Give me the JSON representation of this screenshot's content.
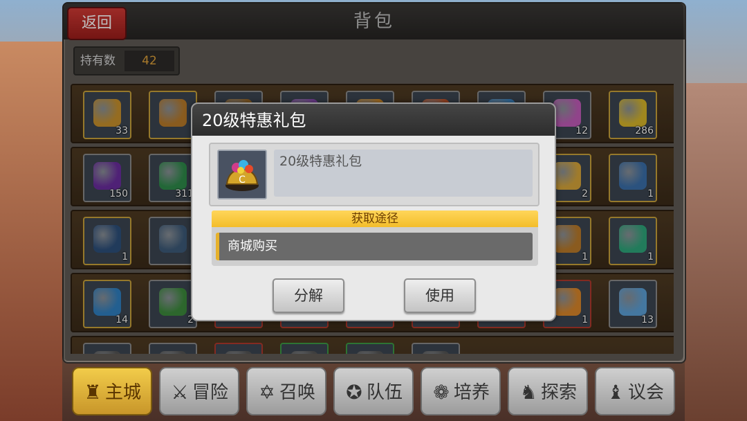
{
  "header": {
    "back_label": "返回",
    "title": "背包"
  },
  "owned": {
    "label": "持有数",
    "count": "42"
  },
  "grid": {
    "rows": [
      [
        {
          "color": "#c7902c",
          "count": "33",
          "border": "gold"
        },
        {
          "color": "#b77a2a",
          "count": "",
          "border": "gold"
        },
        {
          "color": "#9c6b2a",
          "count": "",
          "border": ""
        },
        {
          "color": "#8a4bb0",
          "count": "",
          "border": ""
        },
        {
          "color": "#cf8a2a",
          "count": "",
          "border": ""
        },
        {
          "color": "#c0552b",
          "count": "",
          "border": ""
        },
        {
          "color": "#3b86c4",
          "count": "",
          "border": ""
        },
        {
          "color": "#c05bb8",
          "count": "12",
          "border": ""
        },
        {
          "color": "#d6b52a",
          "count": "286",
          "border": "gold"
        }
      ],
      [
        {
          "color": "#6a2c9e",
          "count": "150",
          "border": ""
        },
        {
          "color": "#2e8a4a",
          "count": "311",
          "border": ""
        },
        {
          "color": "#888",
          "count": "",
          "border": ""
        },
        {
          "color": "#888",
          "count": "",
          "border": ""
        },
        {
          "color": "#888",
          "count": "",
          "border": ""
        },
        {
          "color": "#888",
          "count": "",
          "border": ""
        },
        {
          "color": "#888",
          "count": "",
          "border": ""
        },
        {
          "color": "#d6a53a",
          "count": "2",
          "border": "gold"
        },
        {
          "color": "#3a6ea8",
          "count": "1",
          "border": "gold"
        }
      ],
      [
        {
          "color": "#2d4f7a",
          "count": "1",
          "border": "gold"
        },
        {
          "color": "#3d5a78",
          "count": "",
          "border": ""
        },
        {
          "color": "#888",
          "count": "",
          "border": ""
        },
        {
          "color": "#888",
          "count": "",
          "border": ""
        },
        {
          "color": "#888",
          "count": "",
          "border": ""
        },
        {
          "color": "#888",
          "count": "",
          "border": ""
        },
        {
          "color": "#888",
          "count": "",
          "border": ""
        },
        {
          "color": "#b87a2a",
          "count": "1",
          "border": "gold"
        },
        {
          "color": "#2ea57a",
          "count": "1",
          "border": "gold"
        }
      ],
      [
        {
          "color": "#2f7fc0",
          "count": "14",
          "border": "gold"
        },
        {
          "color": "#3c8a3c",
          "count": "2",
          "border": ""
        },
        {
          "color": "#888",
          "count": "",
          "border": "red"
        },
        {
          "color": "#888",
          "count": "",
          "border": "red"
        },
        {
          "color": "#888",
          "count": "",
          "border": "red"
        },
        {
          "color": "#888",
          "count": "",
          "border": "red"
        },
        {
          "color": "#888",
          "count": "",
          "border": "red"
        },
        {
          "color": "#d9862a",
          "count": "1",
          "border": "red"
        },
        {
          "color": "#5b9fd6",
          "count": "13",
          "border": ""
        }
      ],
      [
        {
          "color": "#555",
          "count": "",
          "border": ""
        },
        {
          "color": "#555",
          "count": "",
          "border": ""
        },
        {
          "color": "#555",
          "count": "",
          "border": "red"
        },
        {
          "color": "#555",
          "count": "",
          "border": "green"
        },
        {
          "color": "#555",
          "count": "",
          "border": "green"
        },
        {
          "color": "#555",
          "count": "",
          "border": ""
        }
      ]
    ]
  },
  "dialog": {
    "title": "20级特惠礼包",
    "item_name": "20级特惠礼包",
    "source_header": "获取途径",
    "source_item": "商城购买",
    "decompose_label": "分解",
    "use_label": "使用"
  },
  "nav": {
    "items": [
      {
        "label": "主城",
        "icon": "castle-icon",
        "glyph": "♜"
      },
      {
        "label": "冒险",
        "icon": "crossed-swords-icon",
        "glyph": "⚔"
      },
      {
        "label": "召唤",
        "icon": "summon-circle-icon",
        "glyph": "✡"
      },
      {
        "label": "队伍",
        "icon": "team-icon",
        "glyph": "✪"
      },
      {
        "label": "培养",
        "icon": "cultivate-icon",
        "glyph": "❁"
      },
      {
        "label": "探索",
        "icon": "explore-icon",
        "glyph": "♞"
      },
      {
        "label": "议会",
        "icon": "council-icon",
        "glyph": "♝"
      }
    ],
    "active_index": 0
  }
}
